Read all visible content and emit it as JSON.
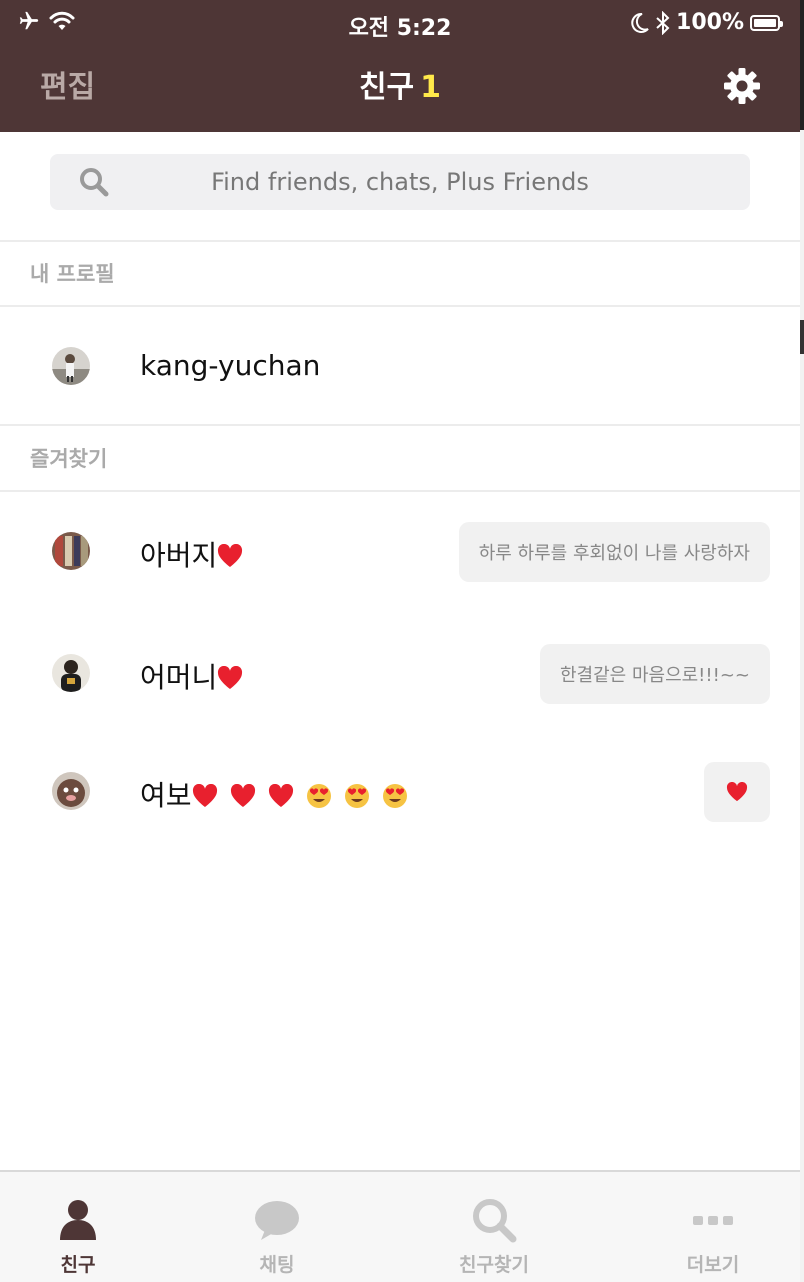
{
  "status_bar": {
    "time": "오전 5:22",
    "battery_percent": "100%"
  },
  "header": {
    "edit_label": "편집",
    "title": "친구",
    "friend_count": "1"
  },
  "search": {
    "placeholder": "Find friends, chats, Plus Friends"
  },
  "sections": {
    "my_profile": "내 프로필",
    "favorites": "즐겨찾기"
  },
  "my_profile": {
    "name": "kang-yuchan"
  },
  "favorites": [
    {
      "name": "아버지",
      "status": "하루 하루를 후회없이 나를 사랑하자"
    },
    {
      "name": "어머니",
      "status": "한결같은 마음으로!!!~~"
    },
    {
      "name": "여보",
      "status_icon": "heart-icon"
    }
  ],
  "tabs": [
    {
      "label": "친구",
      "icon": "person-icon",
      "active": true
    },
    {
      "label": "채팅",
      "icon": "chat-bubble-icon",
      "active": false
    },
    {
      "label": "친구찾기",
      "icon": "search-icon",
      "active": false
    },
    {
      "label": "더보기",
      "icon": "more-icon",
      "active": false
    }
  ],
  "colors": {
    "header_bg": "#4e3636",
    "count_accent": "#ffe94a",
    "heart": "#e8202e",
    "tab_active": "#4e3636",
    "tab_inactive": "#b5b5b5"
  }
}
